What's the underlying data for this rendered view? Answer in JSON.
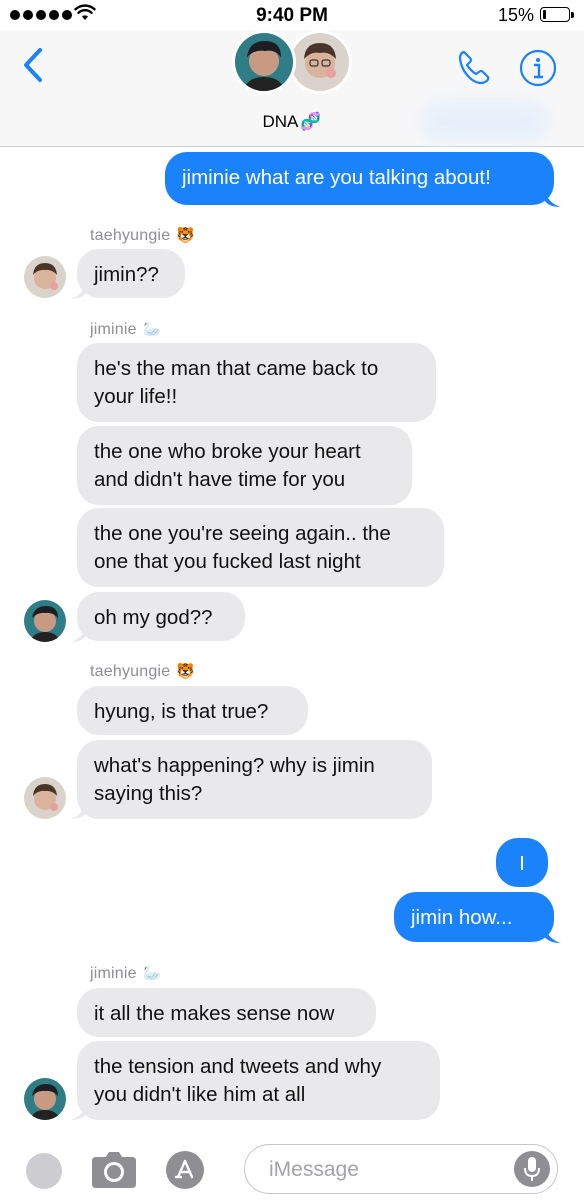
{
  "status_bar": {
    "time": "9:40 PM",
    "battery_percent": "15%",
    "battery_level": 0.15,
    "signal_bars": 5
  },
  "header": {
    "group_name": "DNA",
    "group_emoji": "🧬",
    "back_icon": "chevron-left-icon",
    "call_icon": "phone-icon",
    "info_icon": "info-icon"
  },
  "colors": {
    "accent": "#1a82fb",
    "incoming_bubble": "#e9e9eb",
    "sender_label": "#8e8e93"
  },
  "messages": [
    {
      "id": "m1",
      "direction": "outgoing",
      "text": "jiminie what are you talking about!"
    },
    {
      "id": "m2",
      "direction": "incoming",
      "sender": "taehyungie",
      "sender_emoji": "🐯",
      "text": "jimin??"
    },
    {
      "id": "m3",
      "direction": "incoming",
      "sender": "jiminie",
      "sender_emoji": "🦢",
      "lines": [
        "he's the man that came back to",
        "your life!!"
      ]
    },
    {
      "id": "m4",
      "direction": "incoming",
      "lines": [
        "the one who broke your heart",
        "and didn't have time for you"
      ]
    },
    {
      "id": "m5",
      "direction": "incoming",
      "lines": [
        "the one you're seeing again.. the",
        "one that you fucked last night"
      ]
    },
    {
      "id": "m6",
      "direction": "incoming",
      "text": "oh my god??"
    },
    {
      "id": "m7",
      "direction": "incoming",
      "sender": "taehyungie",
      "sender_emoji": "🐯",
      "text": "hyung, is that true?"
    },
    {
      "id": "m8",
      "direction": "incoming",
      "lines": [
        "what's happening? why is jimin",
        "saying this?"
      ]
    },
    {
      "id": "m9",
      "direction": "outgoing",
      "text": "I"
    },
    {
      "id": "m10",
      "direction": "outgoing",
      "text": "jimin how..."
    },
    {
      "id": "m11",
      "direction": "incoming",
      "sender": "jiminie",
      "sender_emoji": "🦢",
      "text": "it all the makes sense now"
    },
    {
      "id": "m12",
      "direction": "incoming",
      "lines": [
        "the tension and tweets and why",
        "you didn't like him at all"
      ]
    }
  ],
  "input_bar": {
    "placeholder": "iMessage",
    "value": "",
    "camera_icon": "camera-icon",
    "apps_icon": "app-store-icon",
    "mic_icon": "microphone-icon"
  }
}
